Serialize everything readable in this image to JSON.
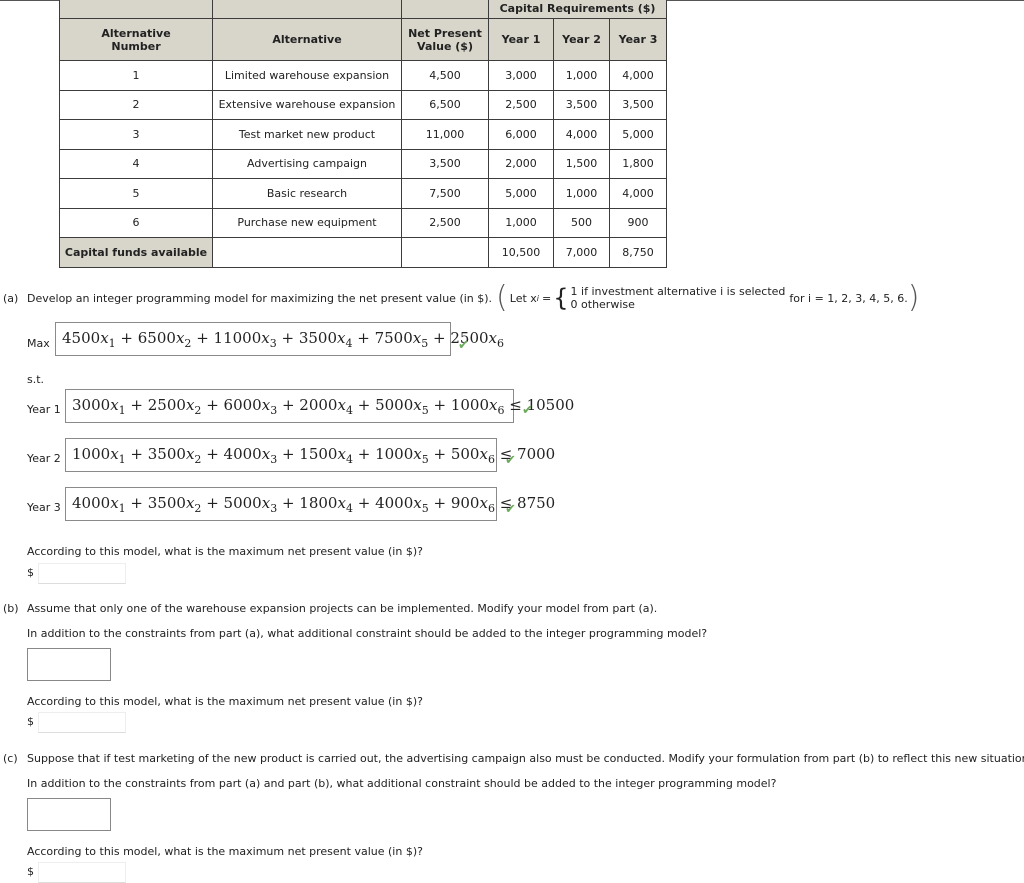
{
  "table": {
    "group_header": "Capital Requirements ($)",
    "headers": [
      "Alternative Number",
      "Alternative",
      "Net Present Value ($)",
      "Year 1",
      "Year 2",
      "Year 3"
    ],
    "rows": [
      {
        "num": "1",
        "name": "Limited warehouse expansion",
        "npv": "4,500",
        "y1": "3,000",
        "y2": "1,000",
        "y3": "4,000"
      },
      {
        "num": "2",
        "name": "Extensive warehouse expansion",
        "npv": "6,500",
        "y1": "2,500",
        "y2": "3,500",
        "y3": "3,500"
      },
      {
        "num": "3",
        "name": "Test market new product",
        "npv": "11,000",
        "y1": "6,000",
        "y2": "4,000",
        "y3": "5,000"
      },
      {
        "num": "4",
        "name": "Advertising campaign",
        "npv": "3,500",
        "y1": "2,000",
        "y2": "1,500",
        "y3": "1,800"
      },
      {
        "num": "5",
        "name": "Basic research",
        "npv": "7,500",
        "y1": "5,000",
        "y2": "1,000",
        "y3": "4,000"
      },
      {
        "num": "6",
        "name": "Purchase new equipment",
        "npv": "2,500",
        "y1": "1,000",
        "y2": "500",
        "y3": "900"
      }
    ],
    "footer": {
      "label": "Capital funds available",
      "y1": "10,500",
      "y2": "7,000",
      "y3": "8,750"
    }
  },
  "part_a": {
    "letter": "(a)",
    "prompt": "Develop an integer programming model for maximizing the net present value (in $).",
    "let_text": "Let x",
    "let_sub": "i",
    "equals": "=",
    "case1": "1 if investment alternative i is selected",
    "case2": "0 otherwise",
    "for_text": "for i = 1, 2, 3, 4, 5, 6.",
    "max_label": "Max",
    "objective": {
      "terms": [
        {
          "coef": "4500",
          "sub": "1"
        },
        {
          "coef": "6500",
          "sub": "2"
        },
        {
          "coef": "11000",
          "sub": "3"
        },
        {
          "coef": "3500",
          "sub": "4"
        },
        {
          "coef": "7500",
          "sub": "5"
        },
        {
          "coef": "2500",
          "sub": "6"
        }
      ]
    },
    "st_label": "s.t.",
    "constraints": [
      {
        "label": "Year 1",
        "coefs": [
          "3000",
          "2500",
          "6000",
          "2000",
          "5000",
          "1000"
        ],
        "rhs": "10500"
      },
      {
        "label": "Year 2",
        "coefs": [
          "1000",
          "3500",
          "4000",
          "1500",
          "1000",
          "500"
        ],
        "rhs": "7000"
      },
      {
        "label": "Year 3",
        "coefs": [
          "4000",
          "3500",
          "5000",
          "1800",
          "4000",
          "900"
        ],
        "rhs": "8750"
      }
    ],
    "question": "According to this model, what is the maximum net present value (in $)?",
    "currency": "$",
    "answer_value": ""
  },
  "part_b": {
    "letter": "(b)",
    "prompt": "Assume that only one of the warehouse expansion projects can be implemented. Modify your model from part (a).",
    "constraint_q": "In addition to the constraints from part (a), what additional constraint should be added to the integer programming model?",
    "constraint_value": "",
    "question": "According to this model, what is the maximum net present value (in $)?",
    "currency": "$",
    "answer_value": ""
  },
  "part_c": {
    "letter": "(c)",
    "prompt": "Suppose that if test marketing of the new product is carried out, the advertising campaign also must be conducted. Modify your formulation from part (b) to reflect this new situation.",
    "constraint_q": "In addition to the constraints from part (a) and part (b), what additional constraint should be added to the integer programming model?",
    "constraint_value": "",
    "question": "According to this model, what is the maximum net present value (in $)?",
    "currency": "$",
    "answer_value": ""
  },
  "icons": {
    "check": "✔"
  },
  "colors": {
    "header_bg": "#d8d5ca",
    "check": "#6aaa5a"
  }
}
